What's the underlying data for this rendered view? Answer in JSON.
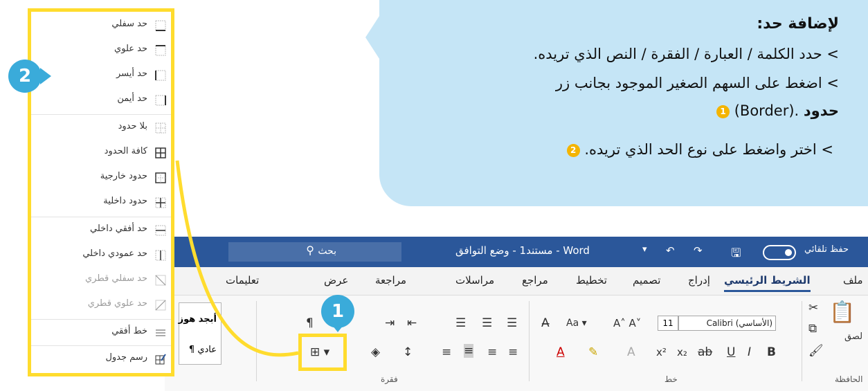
{
  "info": {
    "title": "لإضافة حد:",
    "step1_text": "> حدد الكلمة / العبارة / الفقرة / النص الذي تريده.",
    "step2_text_a": "> اضغط على السهم الصغير الموجود بجانب زر",
    "step2_bold": "حدود",
    "step2_en": "(Border).",
    "step2_marker": "1",
    "step3_text": "> اختر واضغط على نوع الحد الذي تريده.",
    "step3_marker": "2"
  },
  "callouts": {
    "badge_menu": "2",
    "badge_button": "1"
  },
  "titlebar": {
    "autosave_label": "حفظ تلقائي",
    "doc_title": "مستند1 - وضع التوافق - Word",
    "search_placeholder": "بحث"
  },
  "menu_tabs": [
    {
      "label": "ملف"
    },
    {
      "label": "الشريط الرئيسي",
      "active": true
    },
    {
      "label": "إدراج"
    },
    {
      "label": "تصميم"
    },
    {
      "label": "تخطيط"
    },
    {
      "label": "مراجع"
    },
    {
      "label": "مراسلات"
    },
    {
      "label": "مراجعة"
    },
    {
      "label": "عرض"
    },
    {
      "label": "تعليمات"
    }
  ],
  "ribbon": {
    "paste_label": "لصق",
    "clipboard_label": "الحافظة",
    "font_group_label": "خط",
    "paragraph_group_label": "فقرة",
    "font_name": "(الأساسي) Calibri",
    "font_size": "11",
    "style_heading": "أبجد هوز",
    "style_normal": "¶ عادي"
  },
  "border_menu": {
    "items": [
      {
        "label": "حد سفلي",
        "disabled": false
      },
      {
        "label": "حد علوي",
        "disabled": false
      },
      {
        "label": "حد أيسر",
        "disabled": false
      },
      {
        "label": "حد أيمن",
        "disabled": false
      },
      {
        "label": "بلا حدود",
        "disabled": false
      },
      {
        "label": "كافة الحدود",
        "disabled": false
      },
      {
        "label": "حدود خارجية",
        "disabled": false
      },
      {
        "label": "حدود داخلية",
        "disabled": false
      },
      {
        "label": "حد أفقي داخلي",
        "disabled": false
      },
      {
        "label": "حد عمودي داخلي",
        "disabled": false
      },
      {
        "label": "حد سفلي قطري",
        "disabled": true
      },
      {
        "label": "حد علوي قطري",
        "disabled": true
      },
      {
        "label": "خط أفقي",
        "disabled": false
      },
      {
        "label": "رسم جدول",
        "disabled": false
      }
    ]
  },
  "colors": {
    "accent_yellow": "#ffdc2e",
    "callout_blue": "#3aabda",
    "panel_bg": "#c5e5f6",
    "word_blue": "#2b579a"
  }
}
